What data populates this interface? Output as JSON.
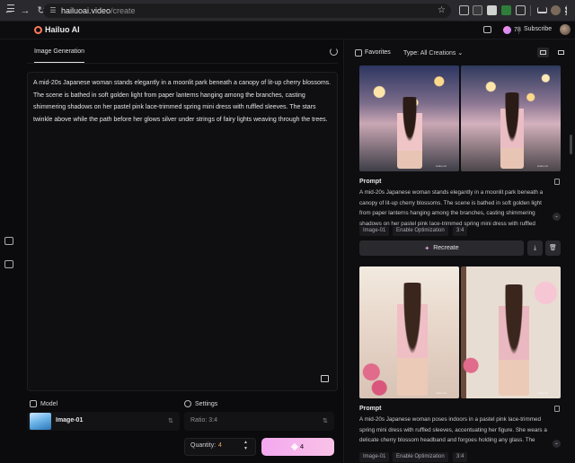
{
  "browser": {
    "url_host": "hailuoai.video",
    "url_path": "/create"
  },
  "app": {
    "brand": "Hailuo AI",
    "credits": "78",
    "subscribe_label": "Subscribe"
  },
  "generator": {
    "tab_label": "Image Generation",
    "prompt": "A mid-20s Japanese woman stands elegantly in a moonlit park beneath a canopy of lit-up cherry blossoms. The scene is bathed in soft golden light from paper lanterns hanging among the branches, casting shimmering shadows on her pastel pink lace-trimmed spring mini dress with ruffled sleeves. The stars twinkle above while the path before her glows silver under strings of fairy lights weaving through the trees.",
    "model_label": "Model",
    "model_name": "Image-01",
    "settings_label": "Settings",
    "ratio_text": "Ratio: 3:4",
    "quantity_label": "Quantity:",
    "quantity_value": "4",
    "generate_cost": "4"
  },
  "history": {
    "favorites_label": "Favorites",
    "type_label": "Type:",
    "type_value": "All Creations",
    "watermark": "Hailuo AI",
    "cards": [
      {
        "prompt_title": "Prompt",
        "prompt_text": "A mid-20s Japanese woman stands elegantly in a moonlit park beneath a canopy of lit-up cherry blossoms. The scene is bathed in soft golden light from paper lanterns hanging among the branches, casting shimmering shadows on her pastel pink lace-trimmed spring mini dress with ruffled sleeves. The s",
        "tags": [
          "Image-01",
          "Enable Optimization",
          "3:4"
        ],
        "recreate_label": "Recreate"
      },
      {
        "prompt_title": "Prompt",
        "prompt_text": "A mid-20s Japanese woman poses indoors in a pastel pink lace-trimmed spring mini dress with ruffled sleeves, accentuating her figure. She wears a delicate cherry blossom headband and forgoes holding any glass. The background features blooming cherry blossoms through large windows, blending the",
        "tags": [
          "Image-01",
          "Enable Optimization",
          "3:4"
        ]
      }
    ]
  }
}
